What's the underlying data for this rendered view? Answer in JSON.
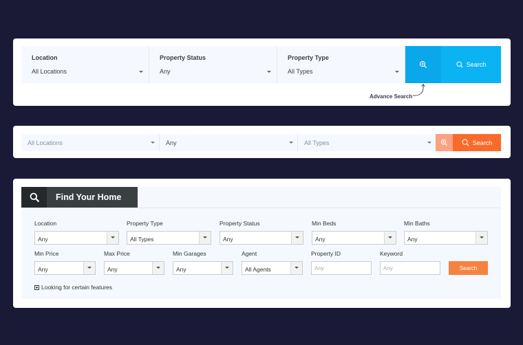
{
  "panel1": {
    "fields": [
      {
        "label": "Location",
        "value": "All Locations"
      },
      {
        "label": "Property Status",
        "value": "Any"
      },
      {
        "label": "Property Type",
        "value": "All Types"
      }
    ],
    "search_label": "Search",
    "advance_label": "Advance Search"
  },
  "panel2": {
    "fields": [
      {
        "value": "All Locations"
      },
      {
        "value": "Any"
      },
      {
        "value": "All Types"
      }
    ],
    "search_label": "Search"
  },
  "panel3": {
    "title": "Find Your Home",
    "row1": [
      {
        "label": "Location",
        "value": "Any"
      },
      {
        "label": "Property Type",
        "value": "All Types"
      },
      {
        "label": "Property Status",
        "value": "Any"
      },
      {
        "label": "Min Beds",
        "value": "Any"
      },
      {
        "label": "Min Baths",
        "value": "Any"
      }
    ],
    "row2": [
      {
        "label": "Min Price",
        "value": "Any"
      },
      {
        "label": "Max Price",
        "value": "Any"
      },
      {
        "label": "Min Garages",
        "value": "Any"
      },
      {
        "label": "Agent",
        "value": "All Agents"
      }
    ],
    "property_id": {
      "label": "Property ID",
      "placeholder": "Any"
    },
    "keyword": {
      "label": "Keyword",
      "placeholder": "Any"
    },
    "search_label": "Search",
    "features_label": "Looking for certain features"
  },
  "colors": {
    "background": "#1a1a36",
    "blue": "#0cb3f2",
    "orange": "#f96a2b",
    "dark": "#3a3f41"
  }
}
